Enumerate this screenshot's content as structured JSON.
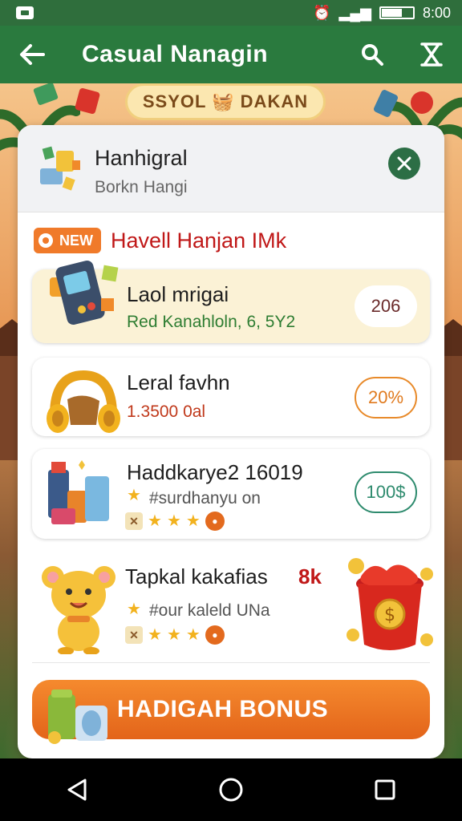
{
  "status_bar": {
    "time": "8:00"
  },
  "app_bar": {
    "title": "Casual Nanagin"
  },
  "banner": {
    "text": "SSYOL 🧺 DAKAN"
  },
  "card": {
    "title": "Hanhigral",
    "subtitle": "Borkn Hangi",
    "section": {
      "badge": "NEW",
      "title": "Havell Hanjan IMk"
    },
    "items": [
      {
        "name": "Laol mrigai",
        "sub": "Red Kanahloln, 6, 5Y2",
        "pill": "206",
        "sub_color": "#2e7d32",
        "pill_color": "#6a2a2a"
      },
      {
        "name": "Leral favhn",
        "sub": "1.3500 0al",
        "pill": "20%",
        "sub_color": "#c0391b",
        "pill_color": "#e07a1e"
      },
      {
        "name": "Haddkarye2 16019",
        "sub": "#surdhanyu on",
        "pill": "100$",
        "sub_color": "#555555",
        "pill_color": "#2e8b6e"
      },
      {
        "name": "Tapkal kakafias",
        "value": "8k",
        "sub": "#our kaleld UNa",
        "sub_color": "#555555"
      }
    ],
    "bonus_button": "HADIGAH BONUS"
  },
  "colors": {
    "app_bar": "#2a7a3e",
    "accent": "#f07a2a",
    "section_title": "#c01818"
  }
}
